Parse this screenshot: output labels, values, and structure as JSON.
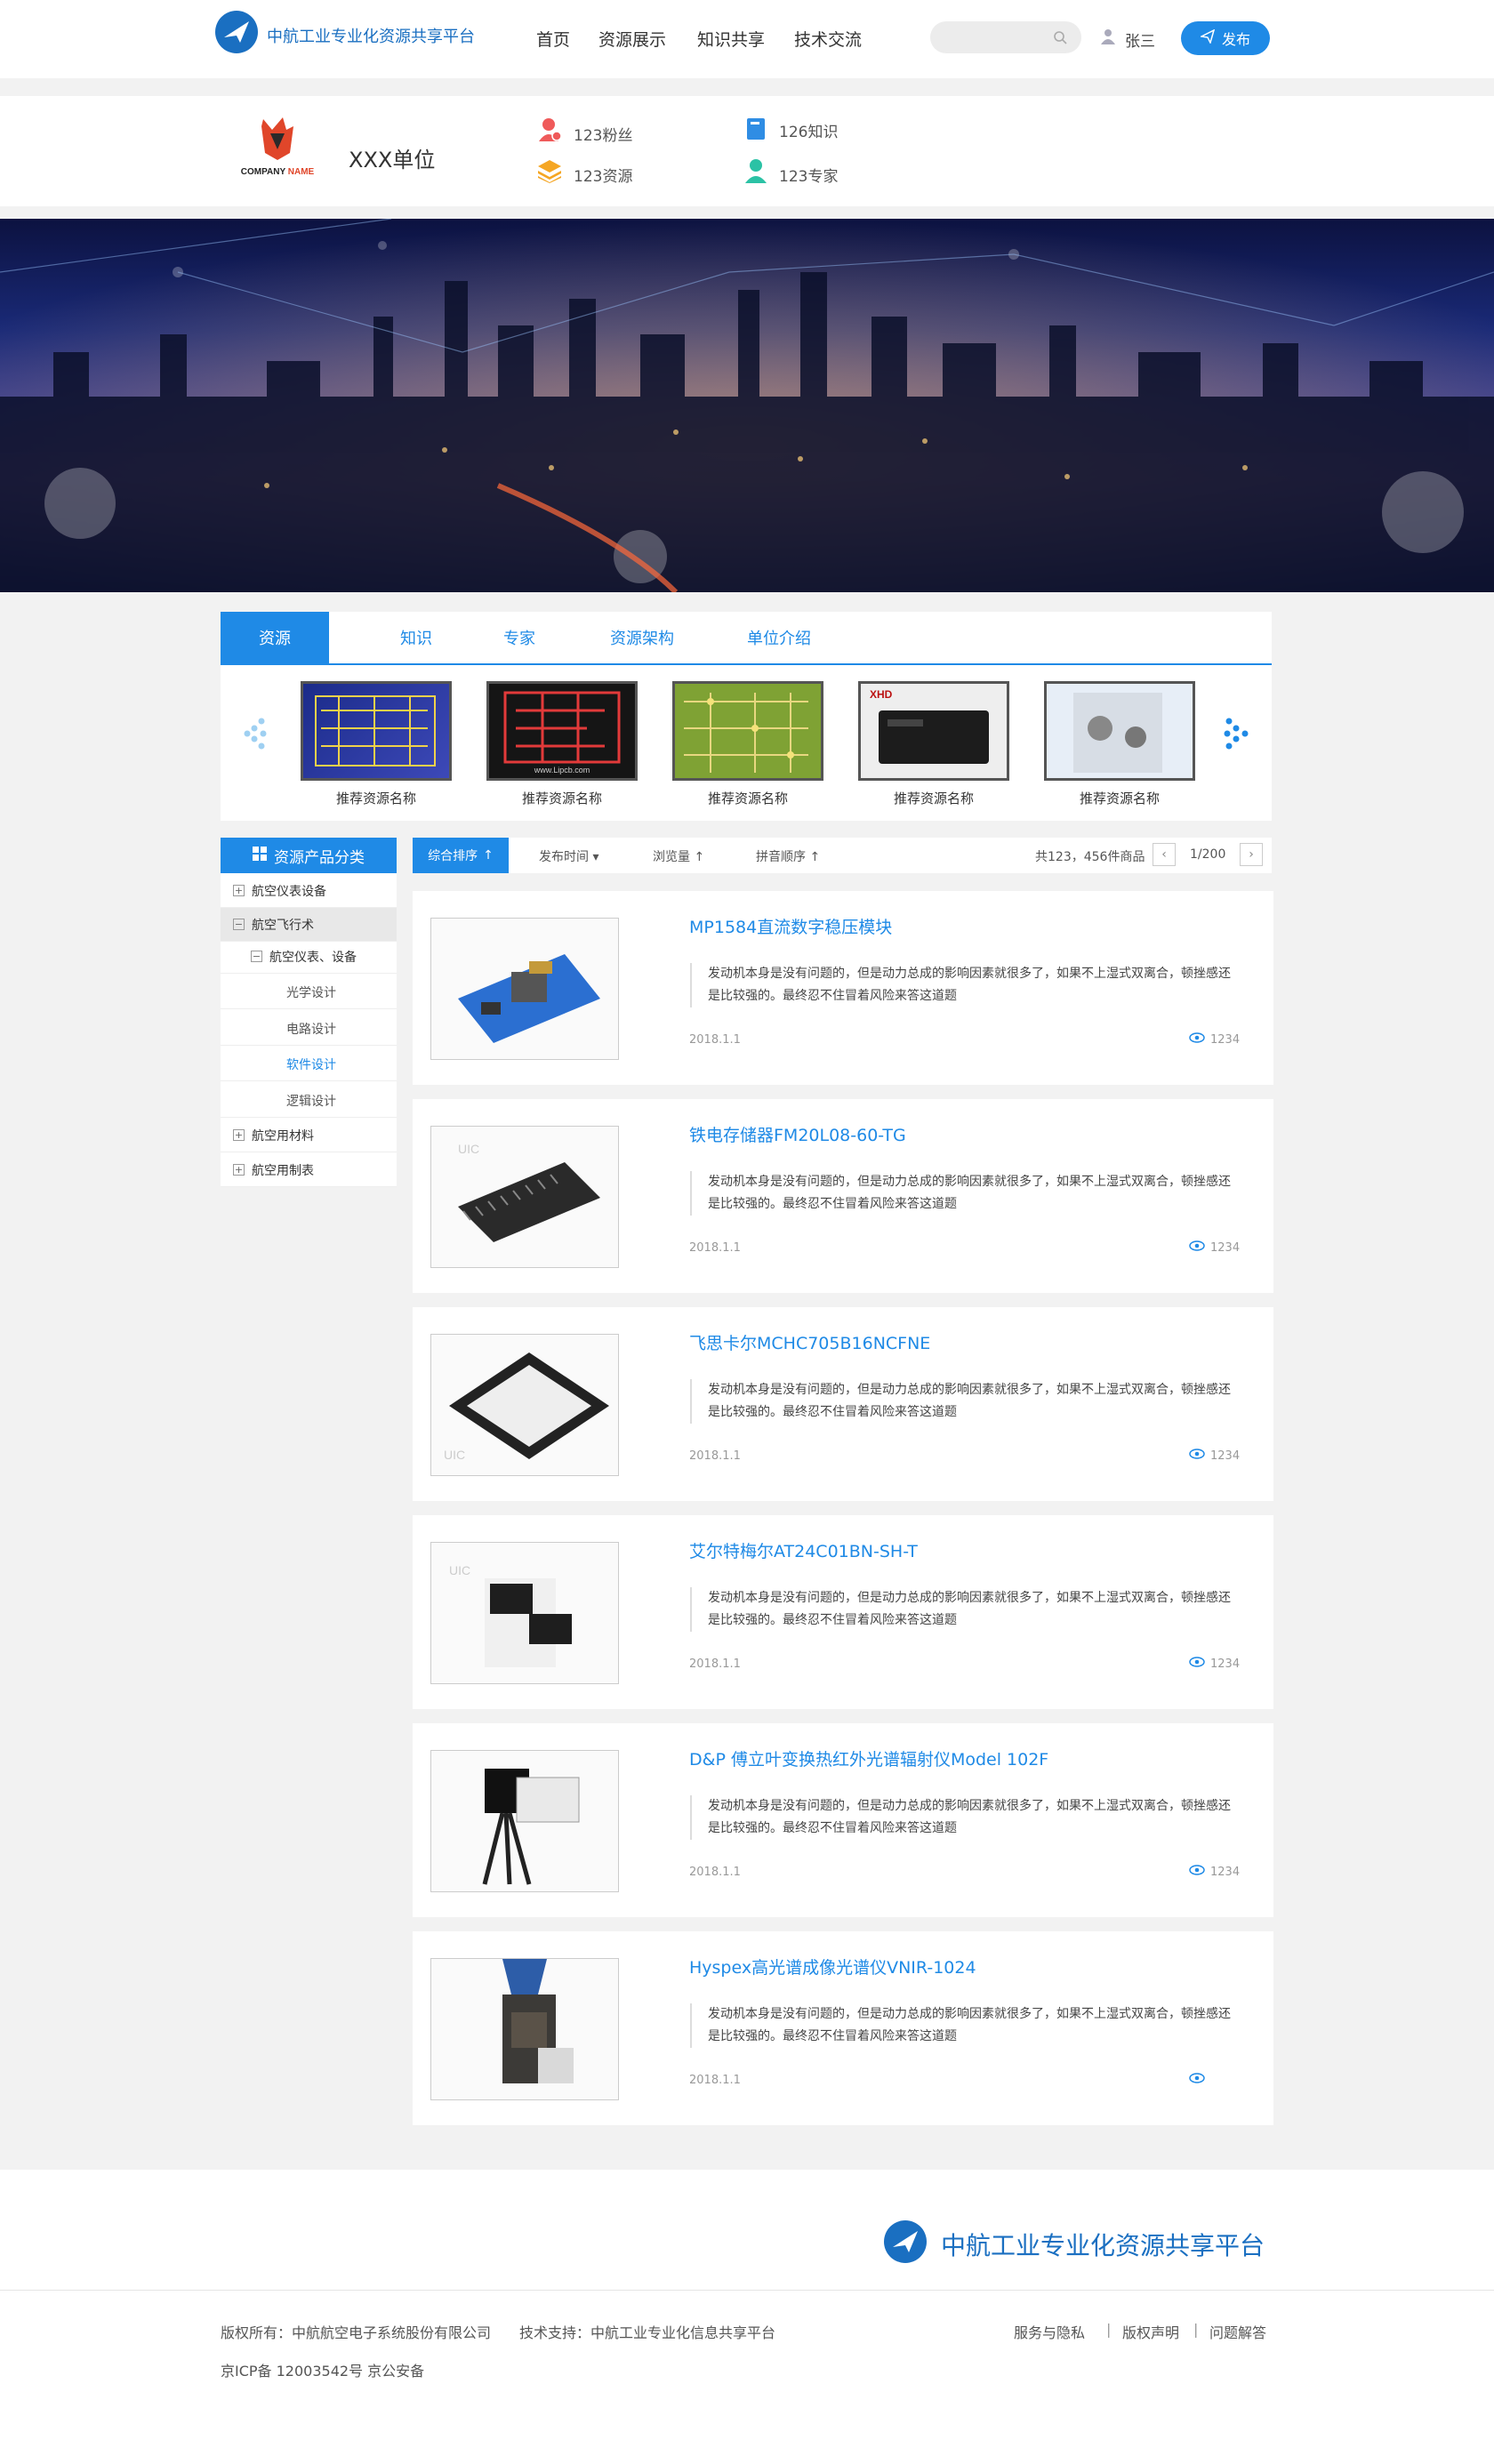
{
  "header": {
    "brand": "中航工业专业化资源共享平台",
    "nav": [
      "首页",
      "资源展示",
      "知识共享",
      "技术交流"
    ],
    "search_placeholder": "",
    "user": "张三",
    "publish": "发布"
  },
  "company": {
    "logo_text": "COMPANY NAME",
    "name": "XXX单位",
    "stats": {
      "fans": "123粉丝",
      "knowledge": "126知识",
      "resources": "123资源",
      "experts": "123专家"
    }
  },
  "tabs": [
    "资源",
    "知识",
    "专家",
    "资源架构",
    "单位介绍"
  ],
  "recommend": {
    "items": [
      "推荐资源名称",
      "推荐资源名称",
      "推荐资源名称",
      "推荐资源名称",
      "推荐资源名称"
    ]
  },
  "sidebar": {
    "title": "资源产品分类",
    "items": [
      "航空仪表设备",
      "航空飞行术",
      "航空仪表、设备",
      "光学设计",
      "电路设计",
      "软件设计",
      "逻辑设计",
      "航空用材料",
      "航空用制表"
    ]
  },
  "sort": {
    "active": "综合排序",
    "options": [
      "发布时间",
      "浏览量",
      "拼音顺序"
    ],
    "total": "共123，456件商品",
    "page": "1/200"
  },
  "cards": [
    {
      "title": "MP1584直流数字稳压模块",
      "desc": "发动机本身是没有问题的，但是动力总成的影响因素就很多了，如果不上湿式双离合，顿挫感还是比较强的。最终忍不住冒着风险来答这道题",
      "date": "2018.1.1",
      "views": "1234"
    },
    {
      "title": "铁电存储器FM20L08-60-TG",
      "desc": "发动机本身是没有问题的，但是动力总成的影响因素就很多了，如果不上湿式双离合，顿挫感还是比较强的。最终忍不住冒着风险来答这道题",
      "date": "2018.1.1",
      "views": "1234"
    },
    {
      "title": "飞思卡尔MCHC705B16NCFNE",
      "desc": "发动机本身是没有问题的，但是动力总成的影响因素就很多了，如果不上湿式双离合，顿挫感还是比较强的。最终忍不住冒着风险来答这道题",
      "date": "2018.1.1",
      "views": "1234"
    },
    {
      "title": "艾尔特梅尔AT24C01BN-SH-T",
      "desc": "发动机本身是没有问题的，但是动力总成的影响因素就很多了，如果不上湿式双离合，顿挫感还是比较强的。最终忍不住冒着风险来答这道题",
      "date": "2018.1.1",
      "views": "1234"
    },
    {
      "title": "D&P 傅立叶变换热红外光谱辐射仪Model 102F",
      "desc": "发动机本身是没有问题的，但是动力总成的影响因素就很多了，如果不上湿式双离合，顿挫感还是比较强的。最终忍不住冒着风险来答这道题",
      "date": "2018.1.1",
      "views": "1234"
    },
    {
      "title": "Hyspex高光谱成像光谱仪VNIR-1024",
      "desc": "发动机本身是没有问题的，但是动力总成的影响因素就很多了，如果不上湿式双离合，顿挫感还是比较强的。最终忍不住冒着风险来答这道题",
      "date": "2018.1.1",
      "views": ""
    }
  ],
  "footer": {
    "brand": "中航工业专业化资源共享平台",
    "copyright": "版权所有：中航航空电子系统股份有限公司",
    "support": "技术支持：中航工业专业化信息共享平台",
    "icp": "京ICP备 12003542号 京公安备",
    "links": [
      "服务与隐私",
      "版权声明",
      "问题解答"
    ]
  },
  "colors": {
    "accent": "#1f8ae6",
    "brand": "#1a6fc1"
  }
}
